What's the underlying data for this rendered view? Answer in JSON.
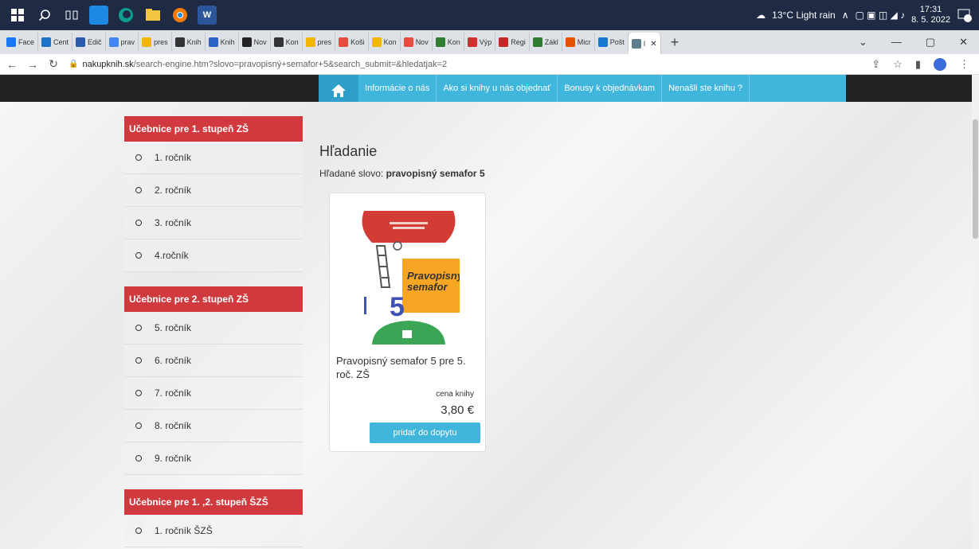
{
  "taskbar": {
    "weather": "13°C Light rain",
    "time": "17:31",
    "date": "8. 5. 2022",
    "notifications": "4"
  },
  "tabs": [
    {
      "label": "Face",
      "color": "#1877f2"
    },
    {
      "label": "Cent",
      "color": "#1a73c8"
    },
    {
      "label": "Edič",
      "color": "#2d5aa8"
    },
    {
      "label": "prav",
      "color": "#4285f4"
    },
    {
      "label": "pres",
      "color": "#f2b705"
    },
    {
      "label": "Knih",
      "color": "#333333"
    },
    {
      "label": "Knih",
      "color": "#2b63c6"
    },
    {
      "label": "Nov",
      "color": "#222222"
    },
    {
      "label": "Kon",
      "color": "#333333"
    },
    {
      "label": "pres",
      "color": "#f2b705"
    },
    {
      "label": "Koši",
      "color": "#e74c3c"
    },
    {
      "label": "Kon",
      "color": "#f2b705"
    },
    {
      "label": "Nov",
      "color": "#e74c3c"
    },
    {
      "label": "Kon",
      "color": "#2e7d32"
    },
    {
      "label": "Výp",
      "color": "#d32f2f"
    },
    {
      "label": "Regi",
      "color": "#c62828"
    },
    {
      "label": "Zákl",
      "color": "#2e7d32"
    },
    {
      "label": "Micr",
      "color": "#e65100"
    },
    {
      "label": "Pošt",
      "color": "#1976d2"
    },
    {
      "label": "I",
      "color": "#607d8b",
      "active": true
    }
  ],
  "address": {
    "domain": "nakupknih.sk",
    "path": "/search-engine.htm?slovo=pravopisný+semafor+5&search_submit=&hledatjak=2"
  },
  "sitenav": {
    "links": [
      "Informácie o nás",
      "Ako si knihy u nás objednať",
      "Bonusy k objednávkam",
      "Nenašli ste knihu ?"
    ]
  },
  "sidebar": {
    "groups": [
      {
        "title": "Učebnice pre 1. stupeň ZŠ",
        "items": [
          "1. ročník",
          "2. ročník",
          "3. ročník",
          "4.ročník"
        ]
      },
      {
        "title": "Učebnice pre 2. stupeň ZŠ",
        "items": [
          "5. ročník",
          "6. ročník",
          "7. ročník",
          "8. ročník",
          "9. ročník"
        ]
      },
      {
        "title": "Učebnice pre 1. ,2. stupeň ŠZŠ",
        "items": [
          "1. ročník ŠZŠ"
        ]
      }
    ]
  },
  "main": {
    "heading": "Hľadanie",
    "search_label": "Hľadané slovo:",
    "search_term": "pravopisný semafor 5",
    "product": {
      "cover_title_line1": "Pravopisný",
      "cover_title_line2": "semafor",
      "cover_number": "5",
      "title": "Pravopisný semafor 5 pre 5. roč. ZŠ",
      "price_label": "cena knihy",
      "price": "3,80 €",
      "button": "pridať do dopytu"
    }
  }
}
